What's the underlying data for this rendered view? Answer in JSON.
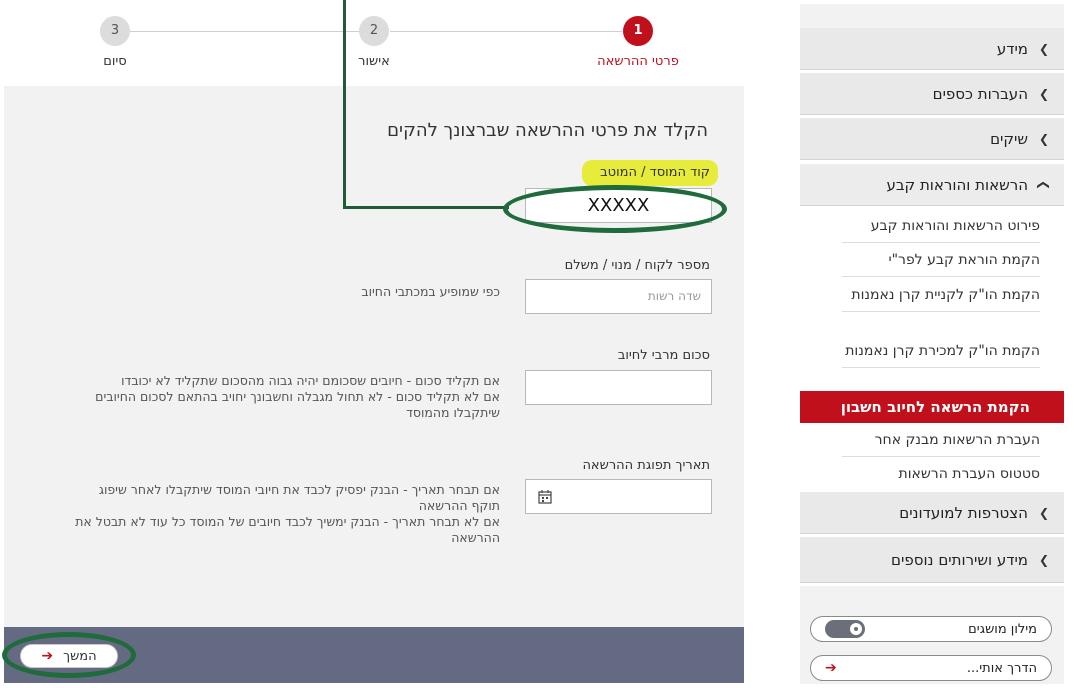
{
  "steps": [
    {
      "number": "1",
      "label": "פרטי ההרשאה"
    },
    {
      "number": "2",
      "label": "אישור"
    },
    {
      "number": "3",
      "label": "סיום"
    }
  ],
  "form": {
    "title": "הקלד את פרטי ההרשאה שברצונך להקים",
    "institution_code_label": "קוד המוסד / המוטב",
    "institution_code_value": "XXXXX",
    "customer_number_label": "מספר לקוח / מנוי / משלם",
    "customer_number_placeholder": "שדה רשות",
    "customer_number_help": "כפי שמופיע במכתבי החיוב",
    "max_amount_label": "סכום מרבי לחיוב",
    "max_amount_help_1": "אם תקליד סכום - חיובים שסכומם יהיה גבוה מהסכום שתקליד לא יכובדו",
    "max_amount_help_2": "אם לא תקליד סכום - לא תחול מגבלה וחשבונך יחויב בהתאם לסכום החיובים שיתקבלו מהמוסד",
    "expiry_label": "תאריך תפוגת ההרשאה",
    "expiry_help_1": "אם תבחר תאריך - הבנק יפסיק לכבד את חיובי המוסד שיתקבלו לאחר שיפוג תוקף ההרשאה",
    "expiry_help_2": "אם לא תבחר תאריך - הבנק ימשיך לכבד חיובים של המוסד כל עוד לא תבטל את ההרשאה"
  },
  "footer": {
    "next_label": "המשך"
  },
  "sidebar": {
    "items": [
      {
        "label": "מידע",
        "icon": "chevron-left"
      },
      {
        "label": "העברות כספים",
        "icon": "chevron-left"
      },
      {
        "label": "שיקים",
        "icon": "chevron-left"
      },
      {
        "label": "הרשאות והוראות קבע",
        "icon": "chevron-down"
      }
    ],
    "sub_items": [
      "פירוט הרשאות והוראות קבע",
      "הקמת הוראת קבע לפר\"י",
      "הקמת הו\"ק לקניית קרן נאמנות",
      "הקמת הו\"ק למכירת קרן נאמנות",
      "הקמת הרשאה לחיוב חשבון",
      "העברת הרשאות מבנק אחר",
      "סטטוס העברת הרשאות"
    ],
    "more_items": [
      {
        "label": "הצטרפות למועדונים",
        "icon": "chevron-left"
      },
      {
        "label": "מידע ושירותים נוספים",
        "icon": "chevron-left"
      }
    ],
    "glossary_label": "מילון מושגים",
    "guide_label": "הדרך אותי..."
  },
  "colors": {
    "brand_red": "#c0101c",
    "footer_bar": "#636a82",
    "annotation_green": "#1f6b3c",
    "highlight_yellow": "#e7ec3a"
  }
}
